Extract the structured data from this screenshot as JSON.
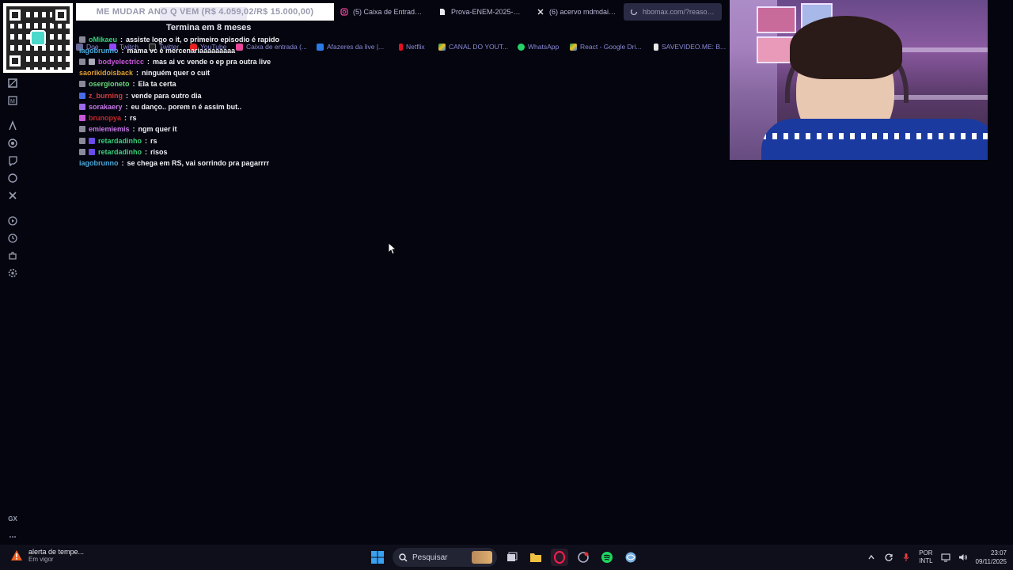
{
  "browser": {
    "tabs": [
      {
        "title": "ME MUDAR ANO Q VEM (R$ 4.059,02/R$ 15.000,00)",
        "kind": "goal"
      },
      {
        "title": "(5) Caixa de Entrada • C",
        "icon": "instagram-icon"
      },
      {
        "title": "Prova-ENEM-2025-AZU",
        "icon": "document-icon"
      },
      {
        "title": "(6) acervo mdmdaiane",
        "icon": "x-icon"
      },
      {
        "title": "hbomax.com/?reason=ar",
        "icon": "loading-icon",
        "kind": "loading"
      }
    ],
    "goal_subtitle": "Termina em 8 meses",
    "bookmarks": [
      {
        "label": "Doe",
        "icon": "bookmark-icon"
      },
      {
        "label": "Twitch",
        "icon": "twitch-icon"
      },
      {
        "label": "Twitter",
        "icon": "x-icon"
      },
      {
        "label": "YouTube",
        "icon": "youtube-icon"
      },
      {
        "label": "Caixa de entrada (...",
        "icon": "mail-icon"
      },
      {
        "label": "Afazeres da live |...",
        "icon": "trello-icon"
      },
      {
        "label": "Netflix",
        "icon": "netflix-icon"
      },
      {
        "label": "CANAL DO YOUT...",
        "icon": "drive-icon"
      },
      {
        "label": "WhatsApp",
        "icon": "whatsapp-icon"
      },
      {
        "label": "React - Google Dri...",
        "icon": "drive-icon"
      },
      {
        "label": "SAVEVIDEO.ME: B...",
        "icon": "savevideo-icon"
      }
    ]
  },
  "chat": {
    "messages": [
      {
        "user": "oMikaeu",
        "text": "assiste logo o it, o primeiro episodio é rapido",
        "color": "#3ad07a"
      },
      {
        "user": "iagobrunno",
        "text": "mama vc é mercenariaaaaaaaaa",
        "color": "#4aa8d8"
      },
      {
        "user": "bodyelectricc",
        "text": "mas ai vc vende o ep pra outra live",
        "color": "#c858d8"
      },
      {
        "user": "saorikidoisback",
        "text": "ninguém quer o cuit",
        "color": "#e0a030"
      },
      {
        "user": "osergioneto",
        "text": "Ela ta certa",
        "color": "#6ad87a"
      },
      {
        "user": "z_burning",
        "text": "vende para outro dia",
        "color": "#d83a3a"
      },
      {
        "user": "sorakaery",
        "text": "eu danço.. porem n é assim but..",
        "color": "#c878e8"
      },
      {
        "user": "brunopya",
        "text": "rs",
        "color": "#c82828"
      },
      {
        "user": "emiemiemis",
        "text": "ngm quer it",
        "color": "#c878e8"
      },
      {
        "user": "retardadinho",
        "text": "rs",
        "color": "#3ad07a"
      },
      {
        "user": "retardadinho",
        "text": "risos",
        "color": "#3ad07a"
      },
      {
        "user": "iagobrunno",
        "text": "se chega em RS, vai sorrindo pra pagarrrr",
        "color": "#4aa8d8"
      }
    ]
  },
  "sidebar": {
    "gx_label": "GX",
    "more_label": "..."
  },
  "taskbar": {
    "weather_title": "alerta de tempe...",
    "weather_sub": "Em vigor",
    "search_placeholder": "Pesquisar",
    "lang_top": "POR",
    "lang_bottom": "INTL",
    "time": "23:07",
    "date": "09/11/2025"
  },
  "colors": {
    "background": "#05050f",
    "taskbar": "#0e0f1a",
    "accent": "#fa1e4e"
  }
}
